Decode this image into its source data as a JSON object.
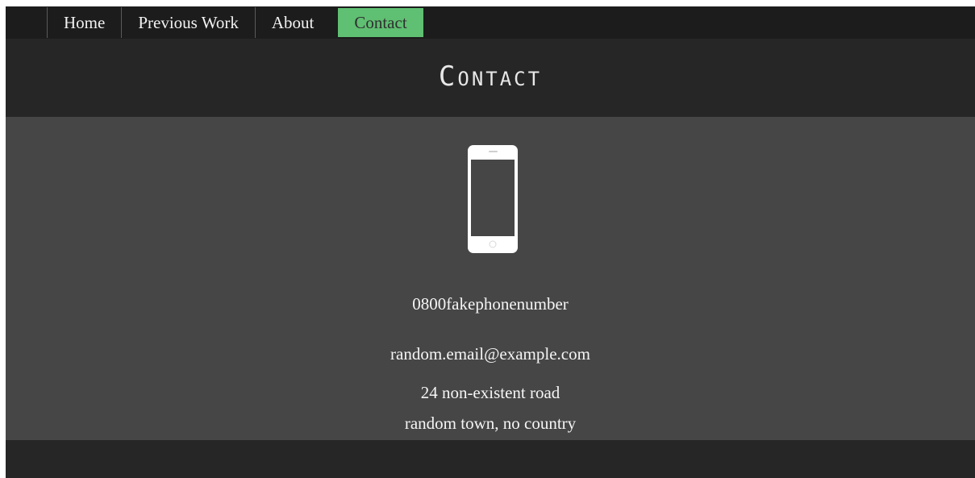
{
  "nav": {
    "items": [
      {
        "label": "Home"
      },
      {
        "label": "Previous Work"
      },
      {
        "label": "About"
      },
      {
        "label": "Contact"
      }
    ],
    "active_item": "Contact",
    "active_color": "#5fbf72"
  },
  "header": {
    "title": "Contact"
  },
  "contact": {
    "icon": "phone-icon",
    "phone": "0800fakephonenumber",
    "email": "random.email@example.com",
    "address_line1": "24 non-existent road",
    "address_line2": "random town, no country"
  },
  "colors": {
    "nav_background": "#1c1c1c",
    "header_background": "#262626",
    "main_background": "#464646",
    "text": "#f5f5f5"
  }
}
